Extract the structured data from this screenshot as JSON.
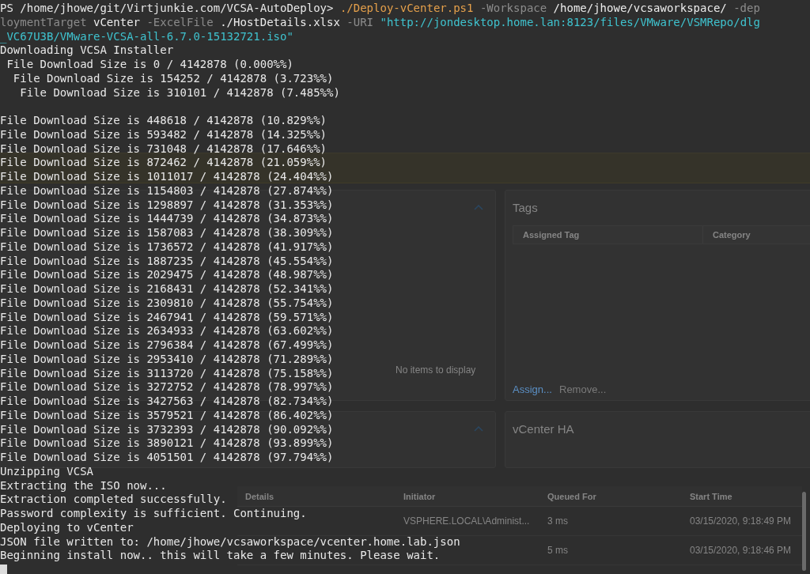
{
  "terminal": {
    "lines": [
      {
        "segments": [
          {
            "kind": "prompt",
            "text": "PS /home/jhowe/git/Virtjunkie.com/VCSA-AutoDeploy> "
          },
          {
            "kind": "command",
            "text": "./Deploy-vCenter.ps1"
          },
          {
            "kind": "param",
            "text": " -Workspace"
          },
          {
            "kind": "arg",
            "text": " /home/jhowe/vcsaworkspace/"
          },
          {
            "kind": "param",
            "text": " -dep"
          }
        ]
      },
      {
        "segments": [
          {
            "kind": "param",
            "text": "loymentTarget"
          },
          {
            "kind": "arg",
            "text": " vCenter"
          },
          {
            "kind": "param",
            "text": " -ExcelFile"
          },
          {
            "kind": "arg",
            "text": " ./HostDetails.xlsx"
          },
          {
            "kind": "param",
            "text": " -URI"
          },
          {
            "kind": "string",
            "text": " \"http://jondesktop.home.lan:8123/files/VMware/VSMRepo/dlg"
          }
        ]
      },
      {
        "segments": [
          {
            "kind": "string",
            "text": "_VC67U3B/VMware-VCSA-all-6.7.0-15132721.iso\""
          }
        ]
      },
      {
        "segments": [
          {
            "kind": "output",
            "text": "Downloading VCSA Installer"
          }
        ]
      },
      {
        "segments": [
          {
            "kind": "output",
            "text": " File Download Size is 0 / 4142878 (0.000%%)"
          }
        ]
      },
      {
        "segments": [
          {
            "kind": "output",
            "text": "  File Download Size is 154252 / 4142878 (3.723%%)"
          }
        ]
      },
      {
        "segments": [
          {
            "kind": "output",
            "text": "   File Download Size is 310101 / 4142878 (7.485%%)"
          }
        ]
      },
      {
        "gap_before": true,
        "segments": [
          {
            "kind": "output",
            "text": "File Download Size is 448618 / 4142878 (10.829%%)"
          }
        ]
      },
      {
        "segments": [
          {
            "kind": "output",
            "text": "File Download Size is 593482 / 4142878 (14.325%%)"
          }
        ]
      },
      {
        "segments": [
          {
            "kind": "output",
            "text": "File Download Size is 731048 / 4142878 (17.646%%)"
          }
        ]
      },
      {
        "segments": [
          {
            "kind": "output",
            "text": "File Download Size is 872462 / 4142878 (21.059%%)"
          }
        ]
      },
      {
        "segments": [
          {
            "kind": "output",
            "text": "File Download Size is 1011017 / 4142878 (24.404%%)"
          }
        ]
      },
      {
        "segments": [
          {
            "kind": "output",
            "text": "File Download Size is 1154803 / 4142878 (27.874%%)"
          }
        ]
      },
      {
        "segments": [
          {
            "kind": "output",
            "text": "File Download Size is 1298897 / 4142878 (31.353%%)"
          }
        ]
      },
      {
        "segments": [
          {
            "kind": "output",
            "text": "File Download Size is 1444739 / 4142878 (34.873%%)"
          }
        ]
      },
      {
        "segments": [
          {
            "kind": "output",
            "text": "File Download Size is 1587083 / 4142878 (38.309%%)"
          }
        ]
      },
      {
        "segments": [
          {
            "kind": "output",
            "text": "File Download Size is 1736572 / 4142878 (41.917%%)"
          }
        ]
      },
      {
        "segments": [
          {
            "kind": "output",
            "text": "File Download Size is 1887235 / 4142878 (45.554%%)"
          }
        ]
      },
      {
        "segments": [
          {
            "kind": "output",
            "text": "File Download Size is 2029475 / 4142878 (48.987%%)"
          }
        ]
      },
      {
        "segments": [
          {
            "kind": "output",
            "text": "File Download Size is 2168431 / 4142878 (52.341%%)"
          }
        ]
      },
      {
        "segments": [
          {
            "kind": "output",
            "text": "File Download Size is 2309810 / 4142878 (55.754%%)"
          }
        ]
      },
      {
        "segments": [
          {
            "kind": "output",
            "text": "File Download Size is 2467941 / 4142878 (59.571%%)"
          }
        ]
      },
      {
        "segments": [
          {
            "kind": "output",
            "text": "File Download Size is 2634933 / 4142878 (63.602%%)"
          }
        ]
      },
      {
        "segments": [
          {
            "kind": "output",
            "text": "File Download Size is 2796384 / 4142878 (67.499%%)"
          }
        ]
      },
      {
        "segments": [
          {
            "kind": "output",
            "text": "File Download Size is 2953410 / 4142878 (71.289%%)"
          }
        ]
      },
      {
        "segments": [
          {
            "kind": "output",
            "text": "File Download Size is 3113720 / 4142878 (75.158%%)"
          }
        ]
      },
      {
        "segments": [
          {
            "kind": "output",
            "text": "File Download Size is 3272752 / 4142878 (78.997%%)"
          }
        ]
      },
      {
        "segments": [
          {
            "kind": "output",
            "text": "File Download Size is 3427563 / 4142878 (82.734%%)"
          }
        ]
      },
      {
        "segments": [
          {
            "kind": "output",
            "text": "File Download Size is 3579521 / 4142878 (86.402%%)"
          }
        ]
      },
      {
        "segments": [
          {
            "kind": "output",
            "text": "File Download Size is 3732393 / 4142878 (90.092%%)"
          }
        ]
      },
      {
        "segments": [
          {
            "kind": "output",
            "text": "File Download Size is 3890121 / 4142878 (93.899%%)"
          }
        ]
      },
      {
        "segments": [
          {
            "kind": "output",
            "text": "File Download Size is 4051501 / 4142878 (97.794%%)"
          }
        ]
      },
      {
        "segments": [
          {
            "kind": "output",
            "text": "Unzipping VCSA"
          }
        ]
      },
      {
        "segments": [
          {
            "kind": "output",
            "text": "Extracting the ISO now..."
          }
        ]
      },
      {
        "segments": [
          {
            "kind": "output",
            "text": "Extraction completed successfully."
          }
        ]
      },
      {
        "segments": [
          {
            "kind": "output",
            "text": "Password complexity is sufficient. Continuing."
          }
        ]
      },
      {
        "segments": [
          {
            "kind": "output",
            "text": "Deploying to vCenter"
          }
        ]
      },
      {
        "segments": [
          {
            "kind": "output",
            "text": "JSON file written to: /home/jhowe/vcsaworkspace/vcenter.home.lab.json"
          }
        ]
      },
      {
        "segments": [
          {
            "kind": "output",
            "text": "Beginning install now.. this will take a few minutes. Please wait."
          }
        ]
      }
    ]
  },
  "background_app": {
    "tags_panel": {
      "title": "Tags",
      "columns": [
        "Assigned Tag",
        "Category"
      ],
      "actions": [
        {
          "label": "Assign...",
          "disabled": false
        },
        {
          "label": "Remove...",
          "disabled": true
        }
      ]
    },
    "left_panel": {
      "empty_message": "No items to display"
    },
    "ha_panel": {
      "title": "vCenter HA"
    },
    "tasks_table": {
      "columns": [
        "Details",
        "Initiator",
        "Queued For",
        "Start Time"
      ],
      "rows": [
        {
          "initiator": "VSPHERE.LOCAL\\Administ...",
          "queued_for": "3 ms",
          "start_time": "03/15/2020, 9:18:49 PM"
        },
        {
          "queued_for": "5 ms",
          "start_time": "03/15/2020, 9:18:46 PM"
        }
      ]
    }
  }
}
